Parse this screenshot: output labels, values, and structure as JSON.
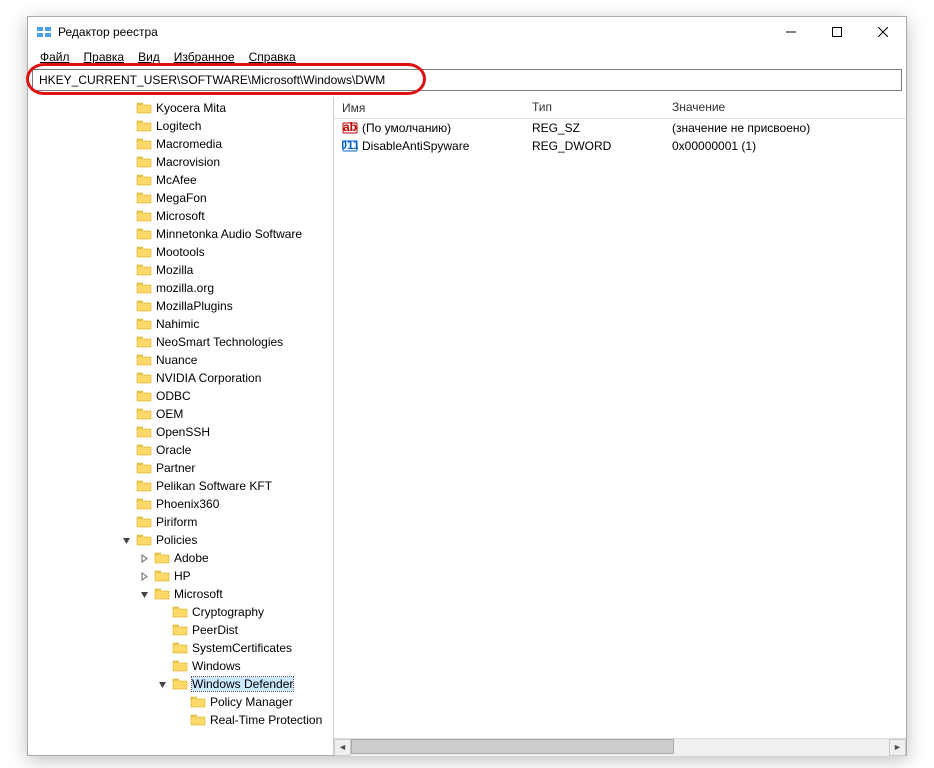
{
  "window": {
    "title": "Редактор реестра"
  },
  "menu": {
    "file": "Файл",
    "edit": "Правка",
    "view": "Вид",
    "favorites": "Избранное",
    "help": "Справка"
  },
  "address": "HKEY_CURRENT_USER\\SOFTWARE\\Microsoft\\Windows\\DWM",
  "columns": {
    "name": "Имя",
    "type": "Тип",
    "value": "Значение"
  },
  "values": [
    {
      "icon": "string",
      "name": "(По умолчанию)",
      "type": "REG_SZ",
      "value": "(значение не присвоено)"
    },
    {
      "icon": "binary",
      "name": "DisableAntiSpyware",
      "type": "REG_DWORD",
      "value": "0x00000001 (1)"
    }
  ],
  "tree": [
    {
      "indent": 4,
      "exp": "",
      "label": "Kyocera Mita"
    },
    {
      "indent": 4,
      "exp": "",
      "label": "Logitech"
    },
    {
      "indent": 4,
      "exp": "",
      "label": "Macromedia"
    },
    {
      "indent": 4,
      "exp": "",
      "label": "Macrovision"
    },
    {
      "indent": 4,
      "exp": "",
      "label": "McAfee"
    },
    {
      "indent": 4,
      "exp": "",
      "label": "MegaFon"
    },
    {
      "indent": 4,
      "exp": "",
      "label": "Microsoft"
    },
    {
      "indent": 4,
      "exp": "",
      "label": "Minnetonka Audio Software"
    },
    {
      "indent": 4,
      "exp": "",
      "label": "Mootools"
    },
    {
      "indent": 4,
      "exp": "",
      "label": "Mozilla"
    },
    {
      "indent": 4,
      "exp": "",
      "label": "mozilla.org"
    },
    {
      "indent": 4,
      "exp": "",
      "label": "MozillaPlugins"
    },
    {
      "indent": 4,
      "exp": "",
      "label": "Nahimic"
    },
    {
      "indent": 4,
      "exp": "",
      "label": "NeoSmart Technologies"
    },
    {
      "indent": 4,
      "exp": "",
      "label": "Nuance"
    },
    {
      "indent": 4,
      "exp": "",
      "label": "NVIDIA Corporation"
    },
    {
      "indent": 4,
      "exp": "",
      "label": "ODBC"
    },
    {
      "indent": 4,
      "exp": "",
      "label": "OEM"
    },
    {
      "indent": 4,
      "exp": "",
      "label": "OpenSSH"
    },
    {
      "indent": 4,
      "exp": "",
      "label": "Oracle"
    },
    {
      "indent": 4,
      "exp": "",
      "label": "Partner"
    },
    {
      "indent": 4,
      "exp": "",
      "label": "Pelikan Software KFT"
    },
    {
      "indent": 4,
      "exp": "",
      "label": "Phoenix360"
    },
    {
      "indent": 4,
      "exp": "",
      "label": "Piriform"
    },
    {
      "indent": 4,
      "exp": "v",
      "label": "Policies"
    },
    {
      "indent": 5,
      "exp": ">",
      "label": "Adobe"
    },
    {
      "indent": 5,
      "exp": ">",
      "label": "HP"
    },
    {
      "indent": 5,
      "exp": "v",
      "label": "Microsoft"
    },
    {
      "indent": 6,
      "exp": "",
      "label": "Cryptography"
    },
    {
      "indent": 6,
      "exp": "",
      "label": "PeerDist"
    },
    {
      "indent": 6,
      "exp": "",
      "label": "SystemCertificates"
    },
    {
      "indent": 6,
      "exp": "",
      "label": "Windows"
    },
    {
      "indent": 6,
      "exp": "v",
      "label": "Windows Defender",
      "selected": true
    },
    {
      "indent": 7,
      "exp": "",
      "label": "Policy Manager"
    },
    {
      "indent": 7,
      "exp": "",
      "label": "Real-Time Protection"
    }
  ]
}
